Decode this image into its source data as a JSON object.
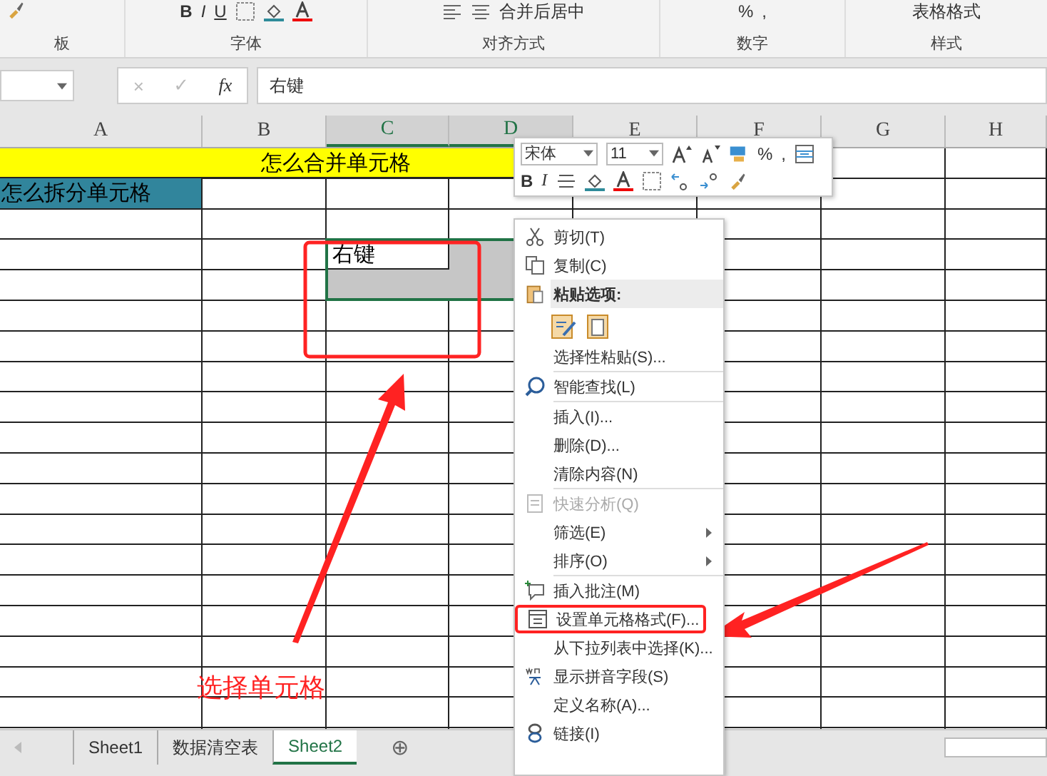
{
  "ribbon": {
    "groups": [
      {
        "label": "板"
      },
      {
        "label": "字体"
      },
      {
        "label": "对齐方式"
      },
      {
        "label": "数字"
      },
      {
        "label": "样式"
      }
    ],
    "font_buttons": [
      "B",
      "I",
      "U"
    ],
    "merge_button": "合并后居中",
    "number_symbols": [
      "%",
      ","
    ],
    "table_format": "表格格式"
  },
  "formula_bar": {
    "cancel": "×",
    "enter": "✓",
    "fx": "fx",
    "value": "右键"
  },
  "columns": [
    "A",
    "B",
    "C",
    "D",
    "E",
    "F",
    "G",
    "H"
  ],
  "sheet": {
    "banner": "怎么合并单元格",
    "subheading": "怎么拆分单元格",
    "active_cell": "右键"
  },
  "mini_toolbar": {
    "font": "宋体",
    "size": "11",
    "symbols": [
      "%",
      ","
    ],
    "buttons": [
      "B",
      "I"
    ]
  },
  "context_menu": [
    {
      "kind": "item",
      "label": "剪切(T)",
      "disabled": false,
      "submenu": false,
      "outlined": false
    },
    {
      "kind": "item",
      "label": "复制(C)",
      "disabled": false,
      "submenu": false,
      "outlined": false
    },
    {
      "kind": "header",
      "label": "粘贴选项:",
      "disabled": false,
      "submenu": false,
      "outlined": false
    },
    {
      "kind": "paste-icons"
    },
    {
      "kind": "item",
      "label": "选择性粘贴(S)...",
      "disabled": false,
      "submenu": false,
      "outlined": false
    },
    {
      "kind": "divider"
    },
    {
      "kind": "item",
      "label": "智能查找(L)",
      "disabled": false,
      "submenu": false,
      "outlined": false
    },
    {
      "kind": "divider"
    },
    {
      "kind": "item",
      "label": "插入(I)...",
      "disabled": false,
      "submenu": false,
      "outlined": false
    },
    {
      "kind": "item",
      "label": "删除(D)...",
      "disabled": false,
      "submenu": false,
      "outlined": false
    },
    {
      "kind": "item",
      "label": "清除内容(N)",
      "disabled": false,
      "submenu": false,
      "outlined": false
    },
    {
      "kind": "divider"
    },
    {
      "kind": "item",
      "label": "快速分析(Q)",
      "disabled": true,
      "submenu": false,
      "outlined": false
    },
    {
      "kind": "item",
      "label": "筛选(E)",
      "disabled": false,
      "submenu": true,
      "outlined": false
    },
    {
      "kind": "item",
      "label": "排序(O)",
      "disabled": false,
      "submenu": true,
      "outlined": false
    },
    {
      "kind": "divider"
    },
    {
      "kind": "item",
      "label": "插入批注(M)",
      "disabled": false,
      "submenu": false,
      "outlined": false
    },
    {
      "kind": "item",
      "label": "设置单元格格式(F)...",
      "disabled": false,
      "submenu": false,
      "outlined": true
    },
    {
      "kind": "item",
      "label": "从下拉列表中选择(K)...",
      "disabled": false,
      "submenu": false,
      "outlined": false
    },
    {
      "kind": "item",
      "label": "显示拼音字段(S)",
      "disabled": false,
      "submenu": false,
      "outlined": false
    },
    {
      "kind": "item",
      "label": "定义名称(A)...",
      "disabled": false,
      "submenu": false,
      "outlined": false
    },
    {
      "kind": "item",
      "label": "链接(I)",
      "disabled": false,
      "submenu": false,
      "outlined": false
    }
  ],
  "sheet_tabs": [
    {
      "label": "Sheet1",
      "selected": false
    },
    {
      "label": "数据清空表",
      "selected": false
    },
    {
      "label": "Sheet2",
      "selected": true
    }
  ],
  "add_sheet": "⊕",
  "annotation": {
    "label": "选择单元格"
  }
}
